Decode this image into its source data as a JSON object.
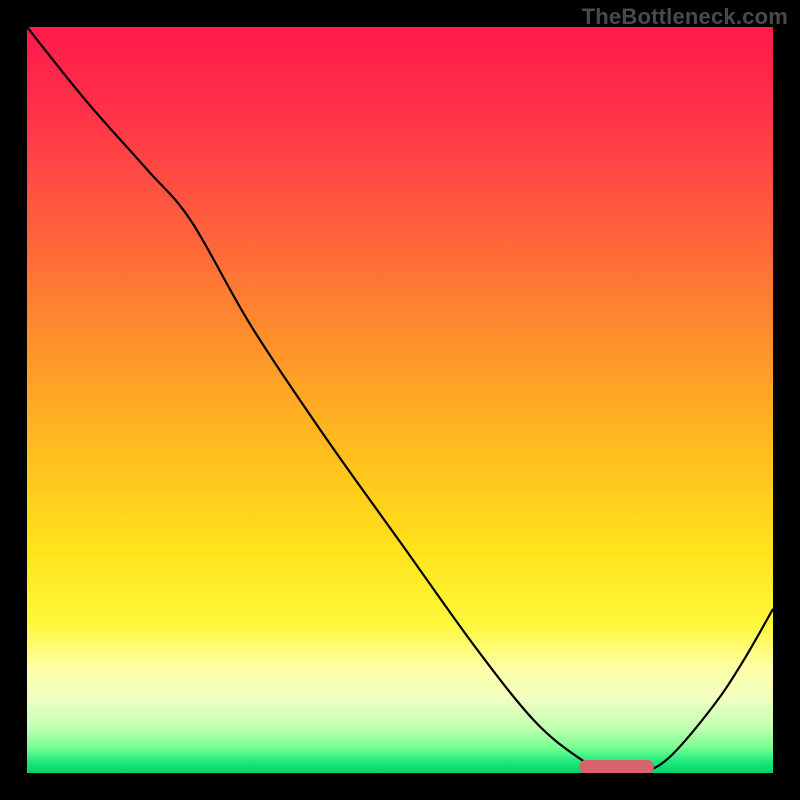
{
  "watermark": "TheBottleneck.com",
  "colors": {
    "black": "#000000",
    "watermark_text": "#4a4a4a",
    "marker": "#d8636f",
    "curve": "#000000",
    "gradient_stops": [
      {
        "offset": 0.0,
        "color": "#ff1a4b"
      },
      {
        "offset": 0.1,
        "color": "#ff2e4a"
      },
      {
        "offset": 0.25,
        "color": "#ff5a3e"
      },
      {
        "offset": 0.4,
        "color": "#ff8a2e"
      },
      {
        "offset": 0.55,
        "color": "#ffb81f"
      },
      {
        "offset": 0.7,
        "color": "#ffe31a"
      },
      {
        "offset": 0.8,
        "color": "#fff83a"
      },
      {
        "offset": 0.86,
        "color": "#ffffa8"
      },
      {
        "offset": 0.9,
        "color": "#f1ffc2"
      },
      {
        "offset": 0.94,
        "color": "#bfffb0"
      },
      {
        "offset": 0.965,
        "color": "#7bff95"
      },
      {
        "offset": 0.985,
        "color": "#20e87a"
      },
      {
        "offset": 1.0,
        "color": "#00d46a"
      }
    ]
  },
  "chart_data": {
    "type": "line",
    "title": "",
    "xlabel": "",
    "ylabel": "",
    "xlim": [
      0,
      100
    ],
    "ylim": [
      0,
      100
    ],
    "grid": false,
    "legend": false,
    "series": [
      {
        "name": "bottleneck-curve",
        "x": [
          0,
          8,
          16,
          22,
          30,
          40,
          50,
          60,
          68,
          74,
          78,
          82,
          86,
          92,
          96,
          100
        ],
        "y": [
          100,
          90,
          81,
          74,
          60,
          45,
          31,
          17,
          7,
          2,
          0,
          0,
          2,
          9,
          15,
          22
        ]
      }
    ],
    "marker": {
      "name": "optimal-range",
      "x_start": 74,
      "x_end": 84,
      "y": 0.8
    }
  }
}
